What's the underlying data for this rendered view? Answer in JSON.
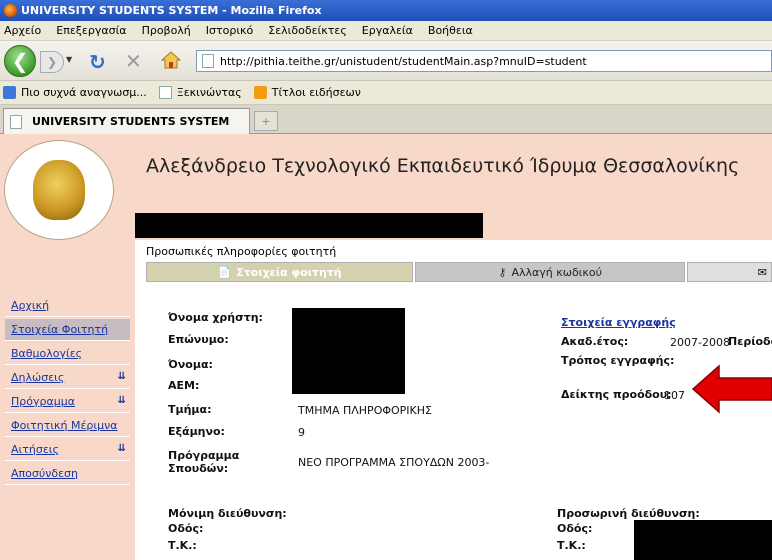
{
  "window": {
    "title": "UNIVERSITY STUDENTS SYSTEM - Mozilla Firefox"
  },
  "menubar": [
    "Αρχείο",
    "Επεξεργασία",
    "Προβολή",
    "Ιστορικό",
    "Σελιδοδείκτες",
    "Εργαλεία",
    "Βοήθεια"
  ],
  "navbar": {
    "url": "http://pithia.teithe.gr/unistudent/studentMain.asp?mnuID=student"
  },
  "bookmarks": [
    "Πιο συχνά αναγνωσμ...",
    "Ξεκινώντας",
    "Τίτλοι ειδήσεων"
  ],
  "tab": {
    "label": "UNIVERSITY STUDENTS SYSTEM",
    "newtab": "+"
  },
  "header": {
    "title": "Αλεξάνδρειο Τεχνολογικό Εκπαιδευτικό Ίδρυμα Θεσσαλονίκης"
  },
  "section": {
    "title": "Προσωπικές πληροφορίες φοιτητή"
  },
  "tabs": [
    {
      "label": "Στοιχεία φοιτητή",
      "active": true
    },
    {
      "label": "Αλλαγή κωδικού",
      "active": false
    },
    {
      "label": "",
      "active": false
    }
  ],
  "sidebar": {
    "items": [
      {
        "label": "Αρχική",
        "submenu": false,
        "selected": false
      },
      {
        "label": "Στοιχεία Φοιτητή",
        "submenu": false,
        "selected": true
      },
      {
        "label": "Βαθμολογίες",
        "submenu": false,
        "selected": false
      },
      {
        "label": "Δηλώσεις",
        "submenu": true,
        "selected": false
      },
      {
        "label": "Πρόγραμμα",
        "submenu": true,
        "selected": false
      },
      {
        "label": "Φοιτητική Μέριμνα",
        "submenu": false,
        "selected": false
      },
      {
        "label": "Αιτήσεις",
        "submenu": true,
        "selected": false
      },
      {
        "label": "Αποσύνδεση",
        "submenu": false,
        "selected": false
      }
    ]
  },
  "student": {
    "username_label": "Όνομα χρήστη:",
    "surname_label": "Επώνυμο:",
    "name_label": "Όνομα:",
    "aem_label": "ΑΕΜ:",
    "dept_label": "Τμήμα:",
    "dept_value": "ΤΜΗΜΑ ΠΛΗΡΟΦΟΡΙΚΗΣ",
    "semester_label": "Εξάμηνο:",
    "semester_value": "9",
    "program_label_1": "Πρόγραμμα",
    "program_label_2": "Σπουδών:",
    "program_value": "ΝΕΟ ΠΡΟΓΡΑΜΜΑ ΣΠΟΥΔΩΝ 2003-"
  },
  "registration": {
    "title": "Στοιχεία εγγραφής",
    "year_label": "Ακαδ.έτος:",
    "year_value": "2007-2008",
    "period_label": "Περίοδο",
    "mode_label": "Τρόπος εγγραφής:",
    "progress_label": "Δείκτης προόδου:",
    "progress_value": "107"
  },
  "address": {
    "permanent_title": "Μόνιμη διεύθυνση:",
    "temp_title": "Προσωρινή διεύθυνση:",
    "street_label": "Οδός:",
    "zip_label": "Τ.Κ.:"
  },
  "colors": {
    "accent_red": "#e00000",
    "link": "#1a35a0",
    "panel": "#f8d9c9"
  }
}
